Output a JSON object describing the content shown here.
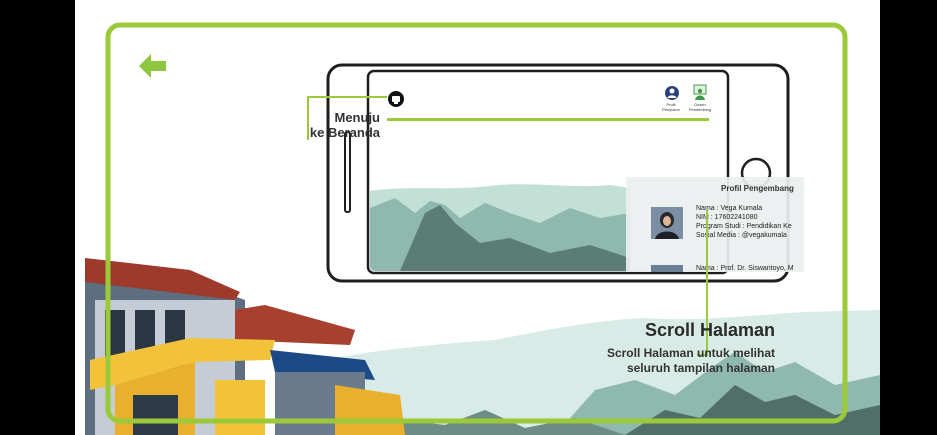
{
  "annotations": {
    "home_label_line1": "Menuju",
    "home_label_line2": "ke Beranda",
    "scroll_title": "Scroll Halaman",
    "scroll_desc_line1": "Scroll Halaman untuk melihat",
    "scroll_desc_line2": "seluruh tampilan halaman"
  },
  "app_header": {
    "profile_label_line1": "Profil",
    "profile_label_line2": "Penyusun",
    "dosen_label_line1": "Dosen",
    "dosen_label_line2": "Pembimbing"
  },
  "panel": {
    "title": "Profil Pengembang",
    "developer_1": {
      "name": "Nama : Vega Kumala",
      "nim": "NIM : 17602241080",
      "program": "Program Studi : Pendidikan Ke",
      "social": "Sosial Media : @vegakumala"
    },
    "developer_2": {
      "name": "Nama : Prof. Dr. Siswantoyo, M"
    }
  },
  "colors": {
    "accent_green": "#9bc93a",
    "back_arrow": "#8fc63f",
    "mountain_teal": "#a9d3c7"
  },
  "icons": {
    "back": "arrow-left-icon",
    "home": "home-icon",
    "profile": "user-icon",
    "dosen": "teacher-icon"
  }
}
